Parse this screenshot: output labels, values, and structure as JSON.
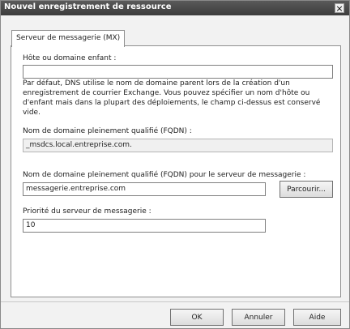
{
  "dialog": {
    "title": "Nouvel enregistrement de ressource",
    "close_glyph": "×"
  },
  "tab": {
    "label": "Serveur de messagerie (MX)"
  },
  "host": {
    "label": "Hôte ou domaine enfant :",
    "value": ""
  },
  "description": "Par défaut, DNS utilise le nom de domaine parent lors de la création d'un enregistrement de courrier Exchange. Vous pouvez spécifier un nom d'hôte ou d'enfant mais dans la plupart des déploiements, le champ ci-dessus est conservé vide.",
  "fqdn": {
    "label": "Nom de domaine pleinement qualifié (FQDN) :",
    "value": "_msdcs.local.entreprise.com."
  },
  "mail_server": {
    "label": "Nom de domaine pleinement qualifié (FQDN) pour le serveur de messagerie :",
    "value": "messagerie.entreprise.com",
    "browse_label": "Parcourir..."
  },
  "priority": {
    "label": "Priorité du serveur de messagerie :",
    "value": "10"
  },
  "buttons": {
    "ok": "OK",
    "cancel": "Annuler",
    "help": "Aide"
  }
}
